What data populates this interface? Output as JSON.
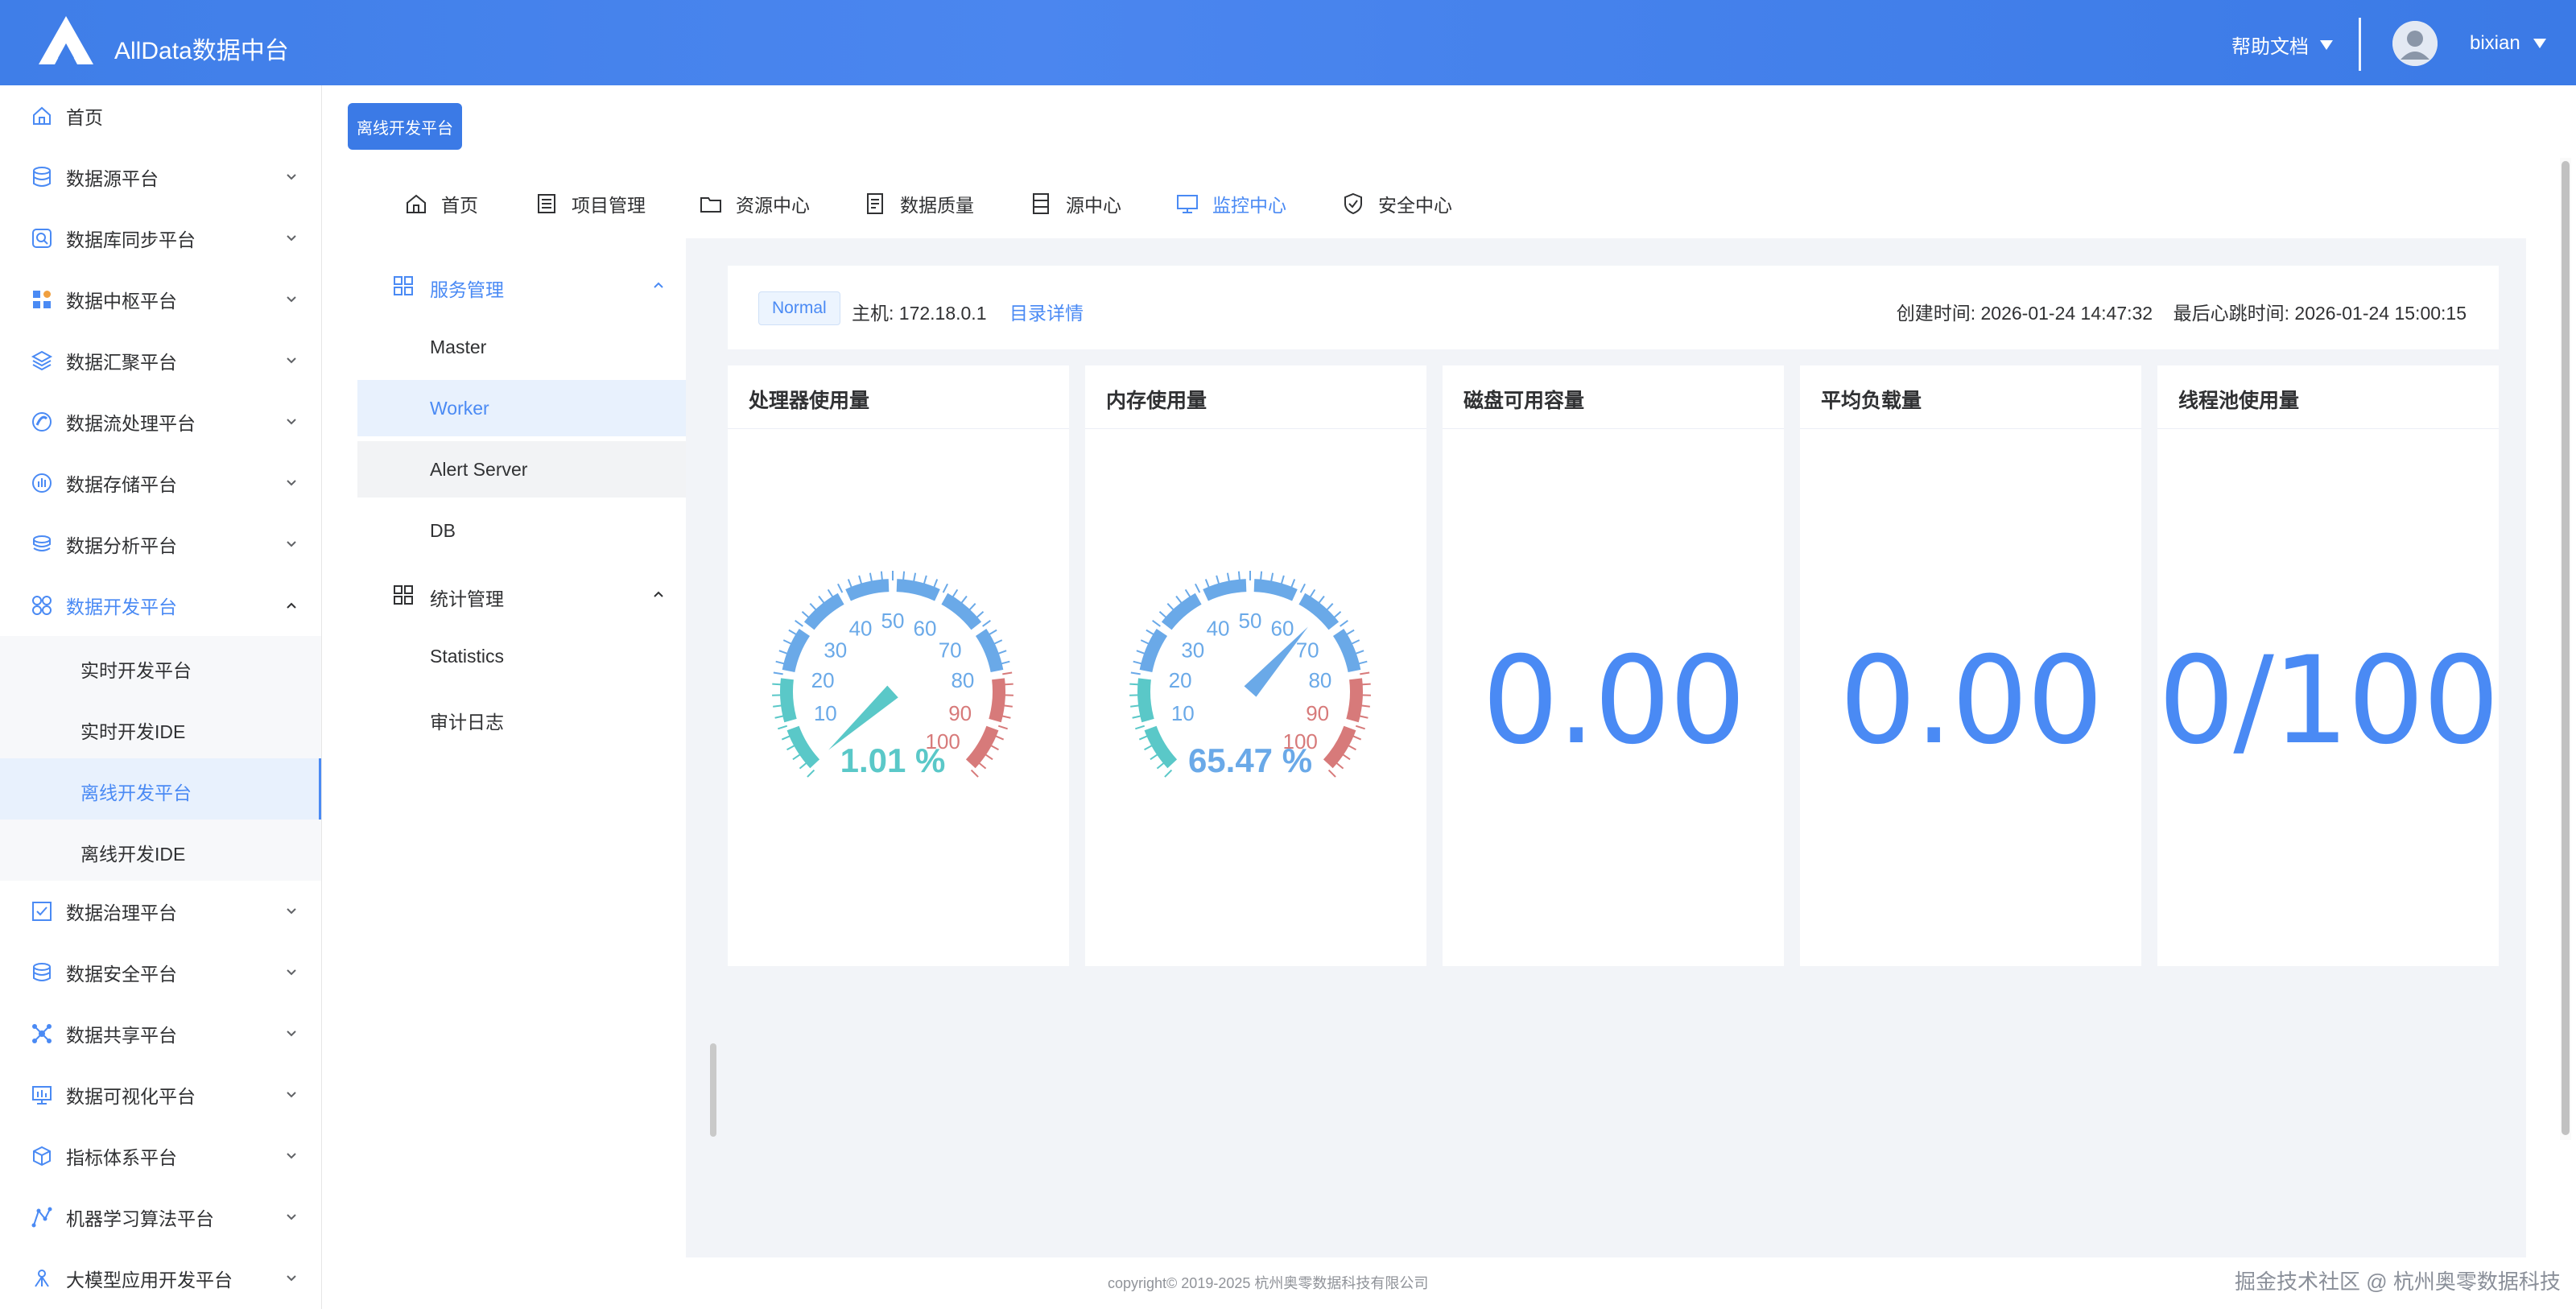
{
  "header": {
    "title": "AllData数据中台",
    "help_label": "帮助文档",
    "username": "bixian"
  },
  "sidebar": {
    "items": [
      {
        "label": "首页",
        "icon": "home-icon"
      },
      {
        "label": "数据源平台",
        "icon": "database-icon"
      },
      {
        "label": "数据库同步平台",
        "icon": "sync-search-icon"
      },
      {
        "label": "数据中枢平台",
        "icon": "grid-blocks-icon"
      },
      {
        "label": "数据汇聚平台",
        "icon": "layers-icon"
      },
      {
        "label": "数据流处理平台",
        "icon": "stream-icon"
      },
      {
        "label": "数据存储平台",
        "icon": "storage-chart-icon"
      },
      {
        "label": "数据分析平台",
        "icon": "analysis-icon"
      },
      {
        "label": "数据开发平台",
        "icon": "dev-cluster-icon"
      },
      {
        "label": "数据治理平台",
        "icon": "governance-check-icon"
      },
      {
        "label": "数据安全平台",
        "icon": "security-db-icon"
      },
      {
        "label": "数据共享平台",
        "icon": "share-network-icon"
      },
      {
        "label": "数据可视化平台",
        "icon": "monitor-chart-icon"
      },
      {
        "label": "指标体系平台",
        "icon": "cube-icon"
      },
      {
        "label": "机器学习算法平台",
        "icon": "ml-graph-icon"
      },
      {
        "label": "大模型应用开发平台",
        "icon": "ai-node-icon"
      }
    ],
    "sub_items": [
      {
        "label": "实时开发平台"
      },
      {
        "label": "实时开发IDE"
      },
      {
        "label": "离线开发平台"
      },
      {
        "label": "离线开发IDE"
      }
    ]
  },
  "main": {
    "platform_button": "离线开发平台",
    "tabs": [
      {
        "label": "首页",
        "icon": "home-icon"
      },
      {
        "label": "项目管理",
        "icon": "list-doc-icon"
      },
      {
        "label": "资源中心",
        "icon": "folder-icon"
      },
      {
        "label": "数据质量",
        "icon": "file-check-icon"
      },
      {
        "label": "源中心",
        "icon": "server-icon"
      },
      {
        "label": "监控中心",
        "icon": "monitor-icon"
      },
      {
        "label": "安全中心",
        "icon": "shield-icon"
      }
    ],
    "subnav": {
      "group1": "服务管理",
      "group1_items": [
        "Master",
        "Worker",
        "Alert Server",
        "DB"
      ],
      "group2": "统计管理",
      "group2_items": [
        "Statistics",
        "审计日志"
      ]
    },
    "info": {
      "status": "Normal",
      "host": "主机: 172.18.0.1",
      "detail_link": "目录详情",
      "times": "创建时间: 2026-01-24 14:47:32    最后心跳时间: 2026-01-24 15:00:15"
    },
    "cards": [
      {
        "title": "处理器使用量",
        "gauge_value": 1.01,
        "gauge_text": "1.01 %"
      },
      {
        "title": "内存使用量",
        "gauge_value": 65.47,
        "gauge_text": "65.47 %"
      },
      {
        "title": "磁盘可用容量",
        "value": "0.00"
      },
      {
        "title": "平均负载量",
        "value": "0.00"
      },
      {
        "title": "线程池使用量",
        "value": "0/100"
      }
    ],
    "gauge_ticks": [
      "10",
      "20",
      "30",
      "40",
      "50",
      "60",
      "70",
      "80",
      "90",
      "100"
    ],
    "gauge_colors": {
      "low": "#5ac8c8",
      "mid": "#6aa9e8",
      "high": "#d77a7a"
    }
  },
  "footer": {
    "copyright": "copyright© 2019-2025 杭州奥零数据科技有限公司",
    "watermark": "掘金技术社区 @ 杭州奥零数据科技"
  }
}
